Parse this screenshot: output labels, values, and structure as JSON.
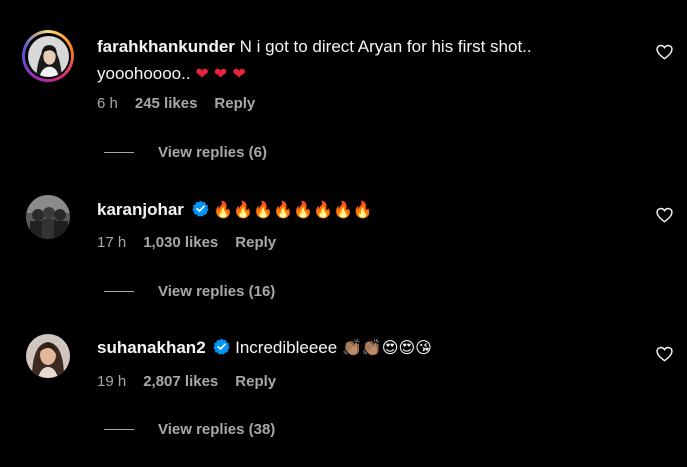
{
  "colors": {
    "background": "#000000",
    "primary_text": "#f5f5f5",
    "secondary_text": "#a8a8a8",
    "verified_badge": "#0095f6",
    "heart_emoji": "#e8243e"
  },
  "comments": [
    {
      "username": "farahkhankunder",
      "verified": false,
      "story_ring": true,
      "text": "N i got to direct Aryan for his first shot.. yooohoooo..",
      "emojis": "❤ ❤ ❤",
      "time": "6 h",
      "likes": "245 likes",
      "reply_label": "Reply",
      "view_replies": "View replies (6)",
      "avatar_icon": "profile-photo-icon",
      "like_icon": "heart-outline-icon"
    },
    {
      "username": "karanjohar",
      "verified": true,
      "story_ring": false,
      "text": "",
      "emojis": "🔥🔥🔥🔥🔥🔥🔥🔥",
      "time": "17 h",
      "likes": "1,030 likes",
      "reply_label": "Reply",
      "view_replies": "View replies (16)",
      "avatar_icon": "profile-photo-icon",
      "like_icon": "heart-outline-icon"
    },
    {
      "username": "suhanakhan2",
      "verified": true,
      "story_ring": false,
      "text": "Incredibleeee",
      "emojis": "👏🏽👏🏽😍😍😘",
      "time": "19 h",
      "likes": "2,807 likes",
      "reply_label": "Reply",
      "view_replies": "View replies (38)",
      "avatar_icon": "profile-photo-icon",
      "like_icon": "heart-outline-icon"
    }
  ]
}
